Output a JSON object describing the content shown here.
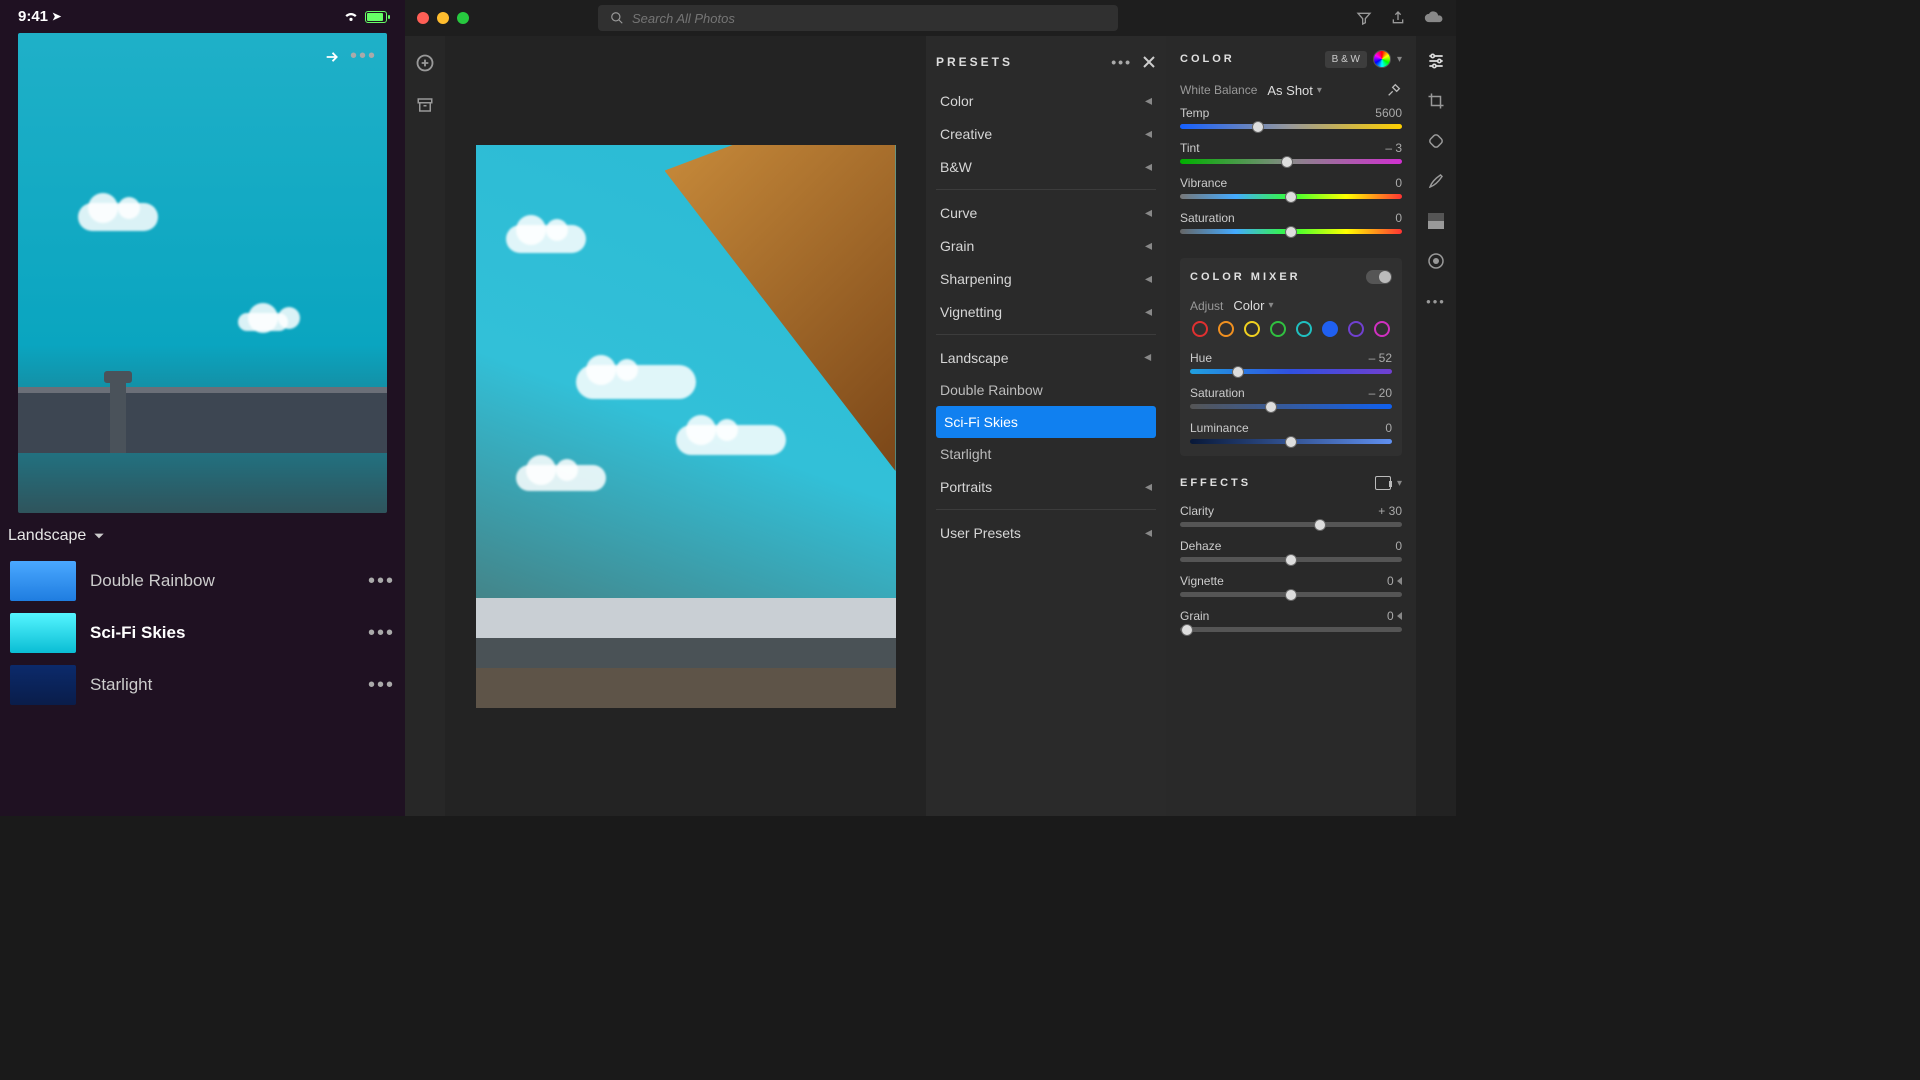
{
  "mobile": {
    "time": "9:41",
    "group_label": "Landscape",
    "presets": [
      {
        "name": "Double Rainbow",
        "selected": false,
        "thumb_gradient": "linear-gradient(180deg,#4aa8ff,#1f7de0)"
      },
      {
        "name": "Sci-Fi Skies",
        "selected": true,
        "thumb_gradient": "linear-gradient(180deg,#55f5ff,#0abdd4)"
      },
      {
        "name": "Starlight",
        "selected": false,
        "thumb_gradient": "linear-gradient(180deg,#0b2a6b,#0a1d4a)"
      }
    ]
  },
  "search_placeholder": "Search All Photos",
  "presets_pane": {
    "title": "PRESETS",
    "top_categories": [
      "Color",
      "Creative",
      "B&W"
    ],
    "mid_categories": [
      "Curve",
      "Grain",
      "Sharpening",
      "Vignetting"
    ],
    "landscape_label": "Landscape",
    "landscape_items": [
      "Double Rainbow",
      "Sci-Fi Skies",
      "Starlight"
    ],
    "landscape_selected": "Sci-Fi Skies",
    "portraits_label": "Portraits",
    "user_presets_label": "User Presets"
  },
  "color": {
    "title": "COLOR",
    "bw_label": "B & W",
    "white_balance_label": "White Balance",
    "white_balance_value": "As Shot",
    "temp": {
      "label": "Temp",
      "value": "5600",
      "pos": 35
    },
    "tint": {
      "label": "Tint",
      "value": "– 3",
      "pos": 48
    },
    "vibrance": {
      "label": "Vibrance",
      "value": "0",
      "pos": 50
    },
    "saturation": {
      "label": "Saturation",
      "value": "0",
      "pos": 50
    }
  },
  "color_mixer": {
    "title": "COLOR MIXER",
    "adjust_label": "Adjust",
    "adjust_value": "Color",
    "swatches": [
      "#e03030",
      "#f09020",
      "#f0d020",
      "#30c040",
      "#20c0c0",
      "#2060f0",
      "#7040d0",
      "#d030c0"
    ],
    "swatch_selected_index": 5,
    "hue": {
      "label": "Hue",
      "value": "– 52",
      "pos": 24
    },
    "saturation": {
      "label": "Saturation",
      "value": "– 20",
      "pos": 40
    },
    "luminance": {
      "label": "Luminance",
      "value": "0",
      "pos": 50
    }
  },
  "effects": {
    "title": "EFFECTS",
    "clarity": {
      "label": "Clarity",
      "value": "+ 30",
      "pos": 63
    },
    "dehaze": {
      "label": "Dehaze",
      "value": "0",
      "pos": 50
    },
    "vignette": {
      "label": "Vignette",
      "value": "0",
      "pos": 50
    },
    "grain": {
      "label": "Grain",
      "value": "0",
      "pos": 3
    }
  }
}
